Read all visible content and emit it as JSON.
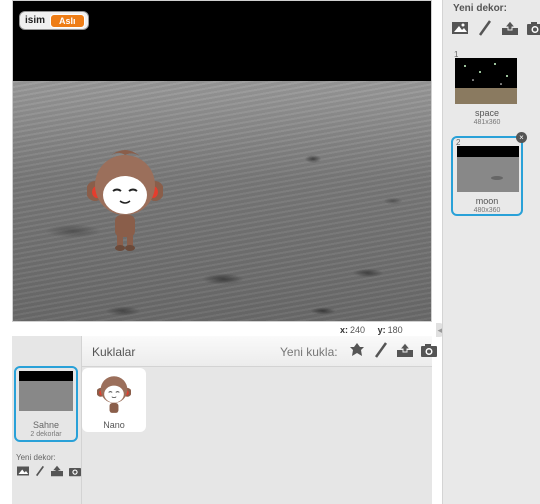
{
  "stage": {
    "variable_monitor": {
      "name": "isim",
      "value": "Aslı"
    },
    "sprite_name": "Nano",
    "coords": {
      "x_label": "x:",
      "x_value": "240",
      "y_label": "y:",
      "y_value": "180"
    }
  },
  "backdrop_panel": {
    "title": "Yeni dekor:",
    "tools": [
      "landscape-icon",
      "paintbrush-icon",
      "upload-icon",
      "camera-icon"
    ],
    "items": [
      {
        "index": "1",
        "name": "space",
        "size": "481x360"
      },
      {
        "index": "2",
        "name": "moon",
        "size": "480x360",
        "selected": true
      }
    ]
  },
  "sprites_panel": {
    "header_label": "Kuklalar",
    "new_sprite_label": "Yeni kukla:",
    "tools": [
      "sprite-library-icon",
      "paintbrush-icon",
      "upload-icon",
      "camera-icon"
    ],
    "stage_item": {
      "name": "Sahne",
      "subtitle": "2 dekorlar"
    },
    "new_backdrop_label": "Yeni dekor:",
    "sprites": [
      {
        "name": "Nano"
      }
    ]
  },
  "colors": {
    "accent_blue": "#29a1d8",
    "variable_orange": "#ee7d16"
  }
}
